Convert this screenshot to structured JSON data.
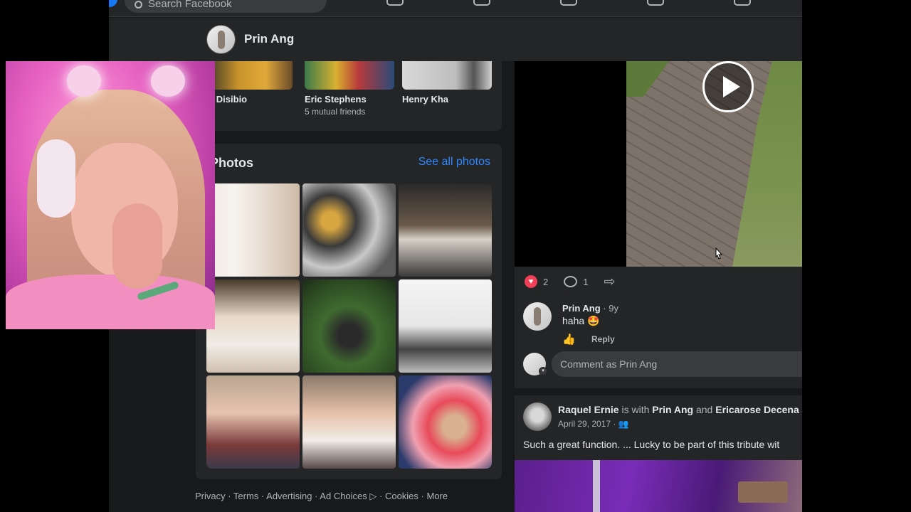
{
  "search": {
    "placeholder": "Search Facebook"
  },
  "profile_bar": {
    "name": "Prin Ang"
  },
  "friends": [
    {
      "name": "im Disibio",
      "mutual": ""
    },
    {
      "name": "Eric Stephens",
      "mutual": "5 mutual friends"
    },
    {
      "name": "Henry Kha",
      "mutual": ""
    }
  ],
  "photos": {
    "title": "Photos",
    "see_all": "See all photos"
  },
  "post": {
    "reactions": {
      "count": "2",
      "heart": "♥"
    },
    "comments_count": "1",
    "comment": {
      "author": "Prin Ang",
      "time": " · 9y",
      "text": "haha 🤩",
      "like_glyph": "👍",
      "reply": "Reply"
    },
    "composer_placeholder": "Comment as Prin Ang"
  },
  "post2": {
    "author": "Raquel Ernie",
    "with_text": " is with ",
    "tagged1": "Prin Ang",
    "and_text": " and ",
    "tagged2": "Ericarose Decena",
    "date": "April 29, 2017 · ",
    "audience_glyph": "👥",
    "text": "Such a great function. ... Lucky to be part of this tribute wit"
  },
  "footer": {
    "links": "Privacy · Terms · Advertising · Ad Choices ▷ · Cookies · More"
  },
  "colors": {
    "accent": "#2d88ff",
    "heart": "#f33e58",
    "fb_blue": "#1877f2",
    "card_bg": "#242526",
    "page_bg": "#18191a"
  },
  "icons": [
    "search-icon",
    "heart-reaction-icon",
    "comment-icon",
    "share-icon",
    "like-icon",
    "play-icon",
    "cursor-icon",
    "friends-audience-icon"
  ]
}
